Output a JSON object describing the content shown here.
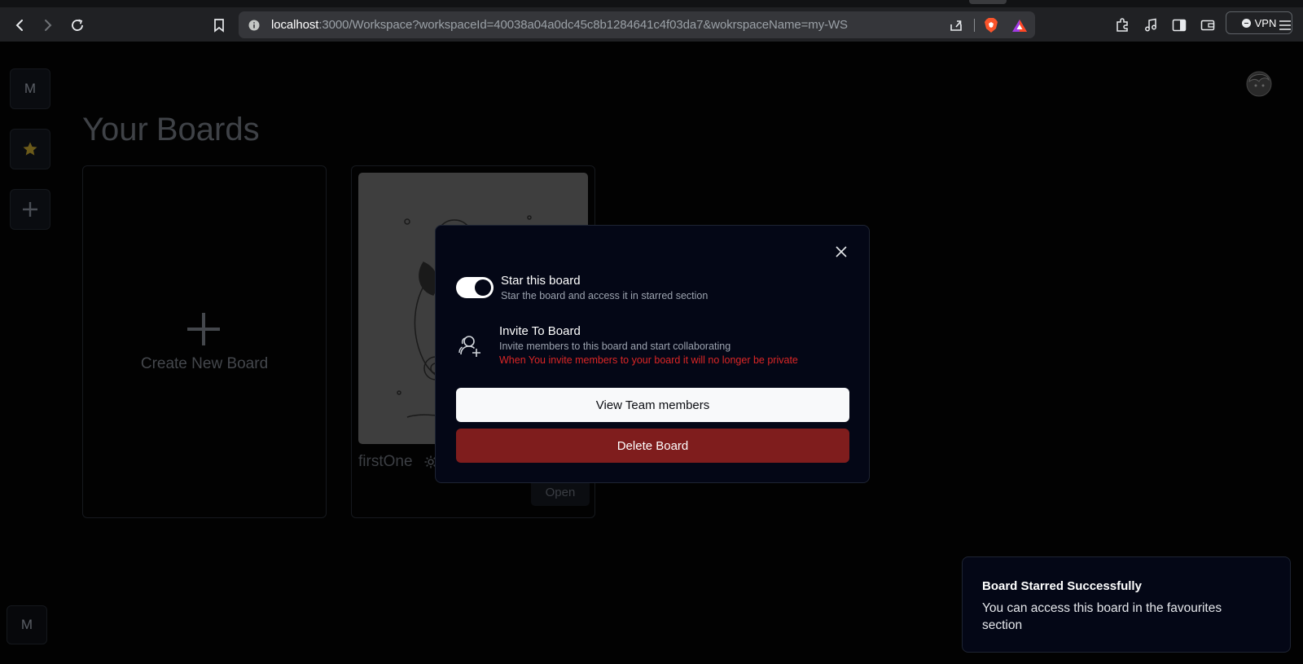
{
  "browser": {
    "url_host": "localhost",
    "url_rest": ":3000/Workspace?workspaceId=40038a04a0dc45c8b1284641c4f03da7&wokrspaceName=my-WS",
    "vpn_label": "VPN"
  },
  "sidebar": {
    "workspace_initial": "M",
    "bottom_initial": "M"
  },
  "page": {
    "heading_word1": "Your",
    "heading_word2": "Boards"
  },
  "boards": {
    "create_label": "Create New Board",
    "items": [
      {
        "name": "firstOne",
        "open_label": "Open"
      }
    ]
  },
  "modal": {
    "star": {
      "title": "Star this board",
      "subtitle": "Star the board and access it in starred section",
      "enabled": true
    },
    "invite": {
      "title": "Invite To Board",
      "subtitle": "Invite members to this board and start collaborating",
      "warning": "When You invite members to your board it will no longer be private"
    },
    "view_members_label": "View Team members",
    "delete_label": "Delete Board"
  },
  "toast": {
    "title": "Board Starred Successfully",
    "message": "You can access this board in the favourites section"
  },
  "colors": {
    "danger": "#7f1d1d",
    "warning_text": "#dc2626",
    "modal_bg": "#040716",
    "star_icon": "#a16207"
  }
}
